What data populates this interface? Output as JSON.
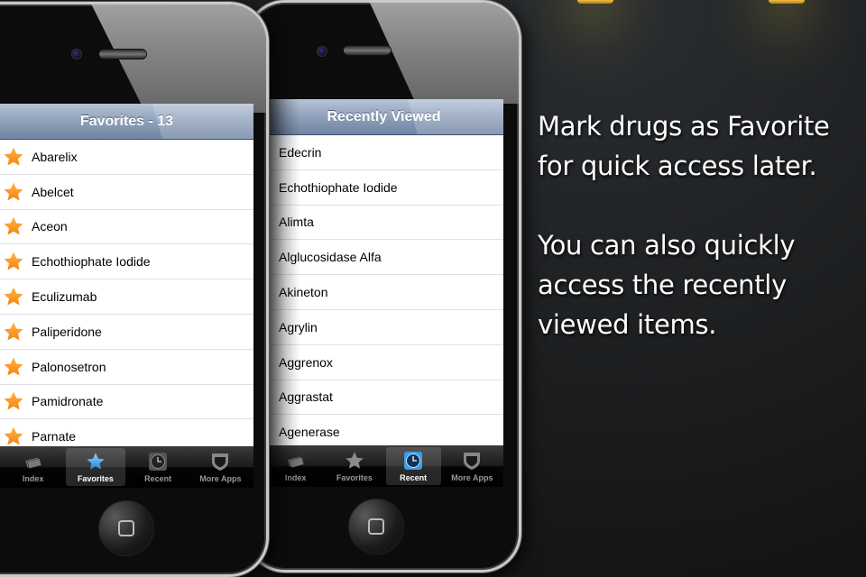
{
  "phones": [
    {
      "title": "Favorites - 13",
      "items": [
        "Abarelix",
        "Abelcet",
        "Aceon",
        "Echothiophate Iodide",
        "Eculizumab",
        "Paliperidone",
        "Palonosetron",
        "Pamidronate",
        "Parnate"
      ],
      "item_icon": "star-icon",
      "tabs": [
        {
          "label": "Index",
          "icon": "index-cards-icon",
          "active": false
        },
        {
          "label": "Favorites",
          "icon": "star-icon",
          "active": true
        },
        {
          "label": "Recent",
          "icon": "clock-icon",
          "active": false
        },
        {
          "label": "More Apps",
          "icon": "shield-icon",
          "active": false
        }
      ]
    },
    {
      "title": "Recently Viewed",
      "items": [
        "Edecrin",
        "Echothiophate Iodide",
        "Alimta",
        "Alglucosidase Alfa",
        "Akineton",
        "Agrylin",
        "Aggrenox",
        "Aggrastat",
        "Agenerase"
      ],
      "tabs": [
        {
          "label": "Index",
          "icon": "index-cards-icon",
          "active": false
        },
        {
          "label": "Favorites",
          "icon": "star-icon",
          "active": false
        },
        {
          "label": "Recent",
          "icon": "clock-icon",
          "active": true
        },
        {
          "label": "More Apps",
          "icon": "shield-icon",
          "active": false
        }
      ]
    }
  ],
  "caption": {
    "line1": "Mark drugs as Favorite for quick access later.",
    "line2": "You can also quickly access the recently viewed items."
  },
  "colors": {
    "star_orange": "#f7931e",
    "navbar_blue": "#8fa0ba",
    "tab_active_star": "#3fa9f5"
  }
}
